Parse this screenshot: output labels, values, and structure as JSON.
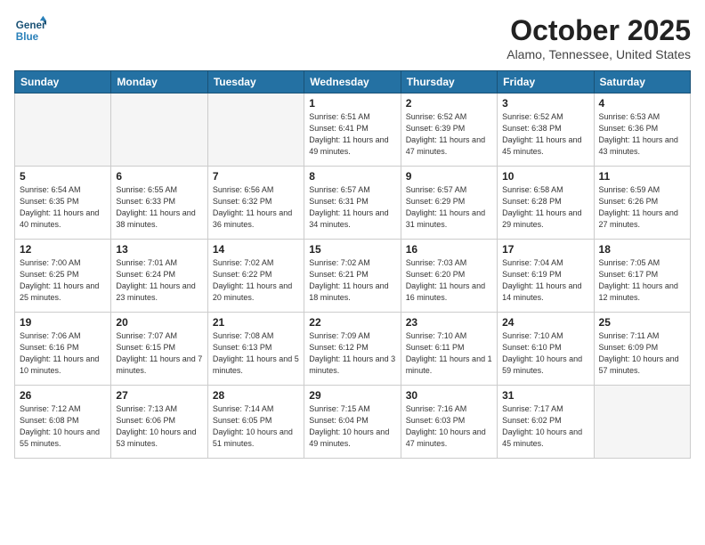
{
  "header": {
    "logo_line1": "General",
    "logo_line2": "Blue",
    "month": "October 2025",
    "location": "Alamo, Tennessee, United States"
  },
  "weekdays": [
    "Sunday",
    "Monday",
    "Tuesday",
    "Wednesday",
    "Thursday",
    "Friday",
    "Saturday"
  ],
  "weeks": [
    [
      {
        "day": "",
        "empty": true
      },
      {
        "day": "",
        "empty": true
      },
      {
        "day": "",
        "empty": true
      },
      {
        "day": "1",
        "info": "Sunrise: 6:51 AM\nSunset: 6:41 PM\nDaylight: 11 hours\nand 49 minutes."
      },
      {
        "day": "2",
        "info": "Sunrise: 6:52 AM\nSunset: 6:39 PM\nDaylight: 11 hours\nand 47 minutes."
      },
      {
        "day": "3",
        "info": "Sunrise: 6:52 AM\nSunset: 6:38 PM\nDaylight: 11 hours\nand 45 minutes."
      },
      {
        "day": "4",
        "info": "Sunrise: 6:53 AM\nSunset: 6:36 PM\nDaylight: 11 hours\nand 43 minutes."
      }
    ],
    [
      {
        "day": "5",
        "info": "Sunrise: 6:54 AM\nSunset: 6:35 PM\nDaylight: 11 hours\nand 40 minutes."
      },
      {
        "day": "6",
        "info": "Sunrise: 6:55 AM\nSunset: 6:33 PM\nDaylight: 11 hours\nand 38 minutes."
      },
      {
        "day": "7",
        "info": "Sunrise: 6:56 AM\nSunset: 6:32 PM\nDaylight: 11 hours\nand 36 minutes."
      },
      {
        "day": "8",
        "info": "Sunrise: 6:57 AM\nSunset: 6:31 PM\nDaylight: 11 hours\nand 34 minutes."
      },
      {
        "day": "9",
        "info": "Sunrise: 6:57 AM\nSunset: 6:29 PM\nDaylight: 11 hours\nand 31 minutes."
      },
      {
        "day": "10",
        "info": "Sunrise: 6:58 AM\nSunset: 6:28 PM\nDaylight: 11 hours\nand 29 minutes."
      },
      {
        "day": "11",
        "info": "Sunrise: 6:59 AM\nSunset: 6:26 PM\nDaylight: 11 hours\nand 27 minutes."
      }
    ],
    [
      {
        "day": "12",
        "info": "Sunrise: 7:00 AM\nSunset: 6:25 PM\nDaylight: 11 hours\nand 25 minutes."
      },
      {
        "day": "13",
        "info": "Sunrise: 7:01 AM\nSunset: 6:24 PM\nDaylight: 11 hours\nand 23 minutes."
      },
      {
        "day": "14",
        "info": "Sunrise: 7:02 AM\nSunset: 6:22 PM\nDaylight: 11 hours\nand 20 minutes."
      },
      {
        "day": "15",
        "info": "Sunrise: 7:02 AM\nSunset: 6:21 PM\nDaylight: 11 hours\nand 18 minutes."
      },
      {
        "day": "16",
        "info": "Sunrise: 7:03 AM\nSunset: 6:20 PM\nDaylight: 11 hours\nand 16 minutes."
      },
      {
        "day": "17",
        "info": "Sunrise: 7:04 AM\nSunset: 6:19 PM\nDaylight: 11 hours\nand 14 minutes."
      },
      {
        "day": "18",
        "info": "Sunrise: 7:05 AM\nSunset: 6:17 PM\nDaylight: 11 hours\nand 12 minutes."
      }
    ],
    [
      {
        "day": "19",
        "info": "Sunrise: 7:06 AM\nSunset: 6:16 PM\nDaylight: 11 hours\nand 10 minutes."
      },
      {
        "day": "20",
        "info": "Sunrise: 7:07 AM\nSunset: 6:15 PM\nDaylight: 11 hours\nand 7 minutes."
      },
      {
        "day": "21",
        "info": "Sunrise: 7:08 AM\nSunset: 6:13 PM\nDaylight: 11 hours\nand 5 minutes."
      },
      {
        "day": "22",
        "info": "Sunrise: 7:09 AM\nSunset: 6:12 PM\nDaylight: 11 hours\nand 3 minutes."
      },
      {
        "day": "23",
        "info": "Sunrise: 7:10 AM\nSunset: 6:11 PM\nDaylight: 11 hours\nand 1 minute."
      },
      {
        "day": "24",
        "info": "Sunrise: 7:10 AM\nSunset: 6:10 PM\nDaylight: 10 hours\nand 59 minutes."
      },
      {
        "day": "25",
        "info": "Sunrise: 7:11 AM\nSunset: 6:09 PM\nDaylight: 10 hours\nand 57 minutes."
      }
    ],
    [
      {
        "day": "26",
        "info": "Sunrise: 7:12 AM\nSunset: 6:08 PM\nDaylight: 10 hours\nand 55 minutes."
      },
      {
        "day": "27",
        "info": "Sunrise: 7:13 AM\nSunset: 6:06 PM\nDaylight: 10 hours\nand 53 minutes."
      },
      {
        "day": "28",
        "info": "Sunrise: 7:14 AM\nSunset: 6:05 PM\nDaylight: 10 hours\nand 51 minutes."
      },
      {
        "day": "29",
        "info": "Sunrise: 7:15 AM\nSunset: 6:04 PM\nDaylight: 10 hours\nand 49 minutes."
      },
      {
        "day": "30",
        "info": "Sunrise: 7:16 AM\nSunset: 6:03 PM\nDaylight: 10 hours\nand 47 minutes."
      },
      {
        "day": "31",
        "info": "Sunrise: 7:17 AM\nSunset: 6:02 PM\nDaylight: 10 hours\nand 45 minutes."
      },
      {
        "day": "",
        "empty": true
      }
    ]
  ]
}
